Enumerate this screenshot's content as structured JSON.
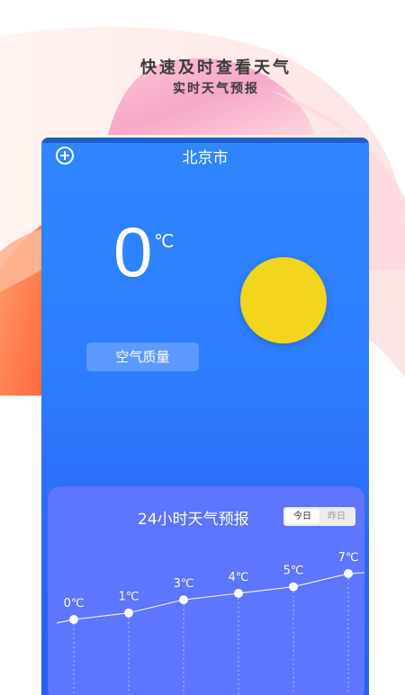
{
  "promo": {
    "title": "快速及时查看天气",
    "subtitle": "实时天气预报"
  },
  "header": {
    "city": "北京市",
    "add_icon": "plus-circle-icon"
  },
  "current": {
    "temperature": "0",
    "unit": "℃",
    "air_quality_label": "空气质量",
    "weather_icon": "sun-icon"
  },
  "forecast": {
    "title": "24小时天气预报",
    "tabs": [
      {
        "label": "今日",
        "active": true
      },
      {
        "label": "昨日",
        "active": false
      }
    ]
  },
  "colors": {
    "card_blue": "#2d7cff",
    "forecast_card": "#5e75ff",
    "sun": "#f2d51c"
  },
  "chart_data": {
    "type": "line",
    "title": "24小时天气预报",
    "x": [
      1,
      2,
      3,
      4,
      5,
      6
    ],
    "values": [
      0,
      1,
      3,
      4,
      5,
      7
    ],
    "labels": [
      "0℃",
      "1℃",
      "3℃",
      "4℃",
      "5℃",
      "7℃"
    ],
    "ylim": [
      0,
      7
    ],
    "grid": false
  }
}
